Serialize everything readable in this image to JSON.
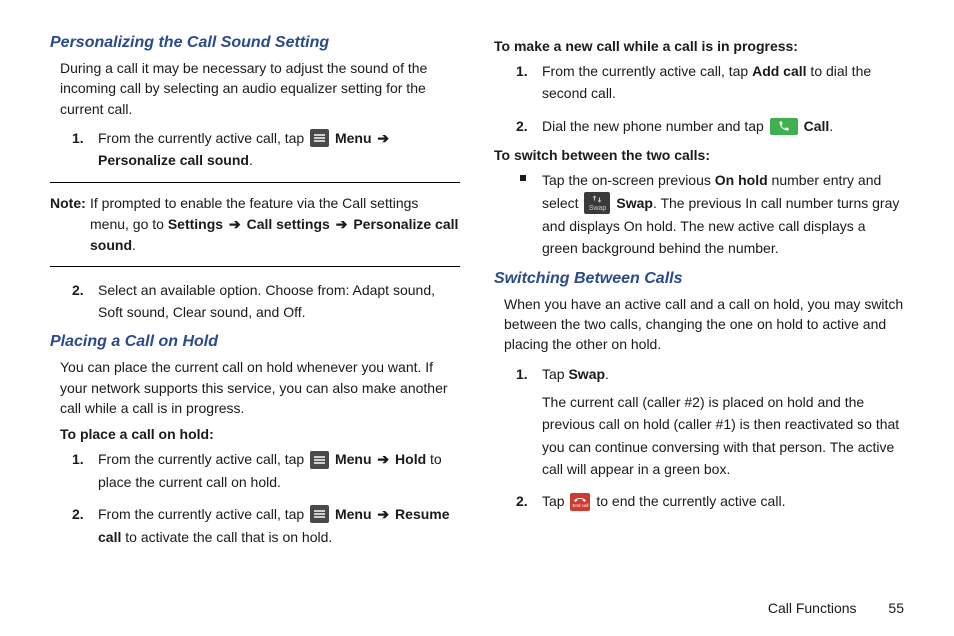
{
  "left": {
    "sec1_title": "Personalizing the Call Sound Setting",
    "sec1_intro": "During a call it may be necessary to adjust the sound of the incoming call by selecting an audio equalizer setting for the current call.",
    "sec1_step1_a": "From the currently active call, tap ",
    "sec1_step1_b_bold": "Menu",
    "sec1_step1_c_bold": "Personalize call sound",
    "sec1_step1_d": ".",
    "note_label": "Note:",
    "note_a": "If prompted to enable the feature via the Call settings menu, go to ",
    "note_b1": "Settings",
    "note_b2": "Call settings",
    "note_b3": "Personalize call sound",
    "note_c": ".",
    "sec1_step2": "Select an available option.  Choose from: Adapt sound, Soft sound, Clear sound, and Off.",
    "sec2_title": "Placing a Call on Hold",
    "sec2_intro": "You can place the current call on hold whenever you want. If your network supports this service, you can also make another call while a call is in progress.",
    "sec2_sub": "To place a call on hold:",
    "sec2_s1_a": "From the currently active call, tap ",
    "sec2_s1_b1": "Menu",
    "sec2_s1_b2": "Hold",
    "sec2_s1_c": " to place the current call on hold.",
    "sec2_s2_a": "From the currently active call, tap ",
    "sec2_s2_b1": "Menu",
    "sec2_s2_b2": "Resume call",
    "sec2_s2_c": " to activate the call that is on hold."
  },
  "right": {
    "r_sub1": "To make a new call while a call is in progress:",
    "r1_s1_a": "From the currently active call, tap ",
    "r1_s1_b": "Add call",
    "r1_s1_c": " to dial the second call.",
    "r1_s2_a": "Dial the new phone number and tap ",
    "r1_s2_b": "Call",
    "r1_s2_c": ".",
    "r_sub2": "To switch between the two calls:",
    "r2_b_a": "Tap the on-screen previous ",
    "r2_b_b": "On hold",
    "r2_b_c": " number entry and select ",
    "r2_b_d": "Swap",
    "r2_b_e": ". The previous In call number turns gray and displays On hold. The new active call displays a green background behind the number.",
    "sec3_title": "Switching Between Calls",
    "sec3_intro": "When you have an active call and a call on hold, you may switch between the two calls, changing the one on hold to active and placing the other on hold.",
    "s3_s1_a": "Tap ",
    "s3_s1_b": "Swap",
    "s3_s1_c": ".",
    "s3_s1_body": "The current call (caller #2) is placed on hold and the previous call on hold (caller #1) is then reactivated so that you can continue conversing with that person. The active call will appear in a green box.",
    "s3_s2_a": "Tap ",
    "s3_s2_b": " to end the currently active call."
  },
  "footer": {
    "chapter": "Call Functions",
    "page": "55"
  },
  "icons": {
    "swap_label": "Swap",
    "end_label": "End call"
  }
}
